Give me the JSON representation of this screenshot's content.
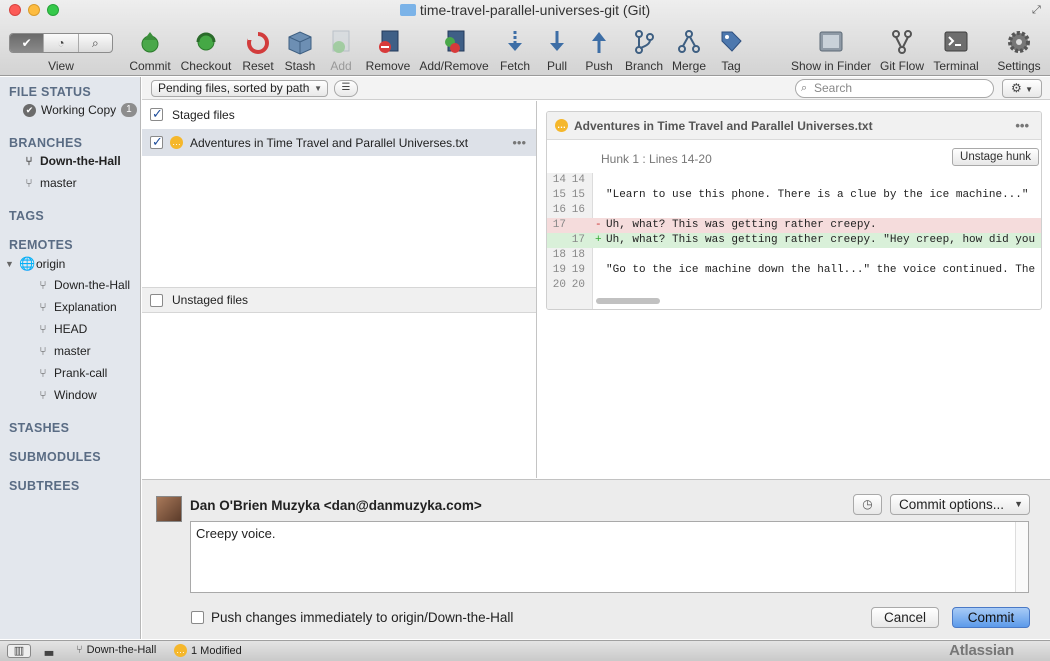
{
  "window": {
    "title": "time-travel-parallel-universes-git (Git)"
  },
  "toolbar": {
    "view_label": "View",
    "buttons": [
      {
        "label": "Commit",
        "icon": "commit-icon",
        "enabled": true
      },
      {
        "label": "Checkout",
        "icon": "checkout-icon",
        "enabled": true
      },
      {
        "label": "Reset",
        "icon": "reset-icon",
        "enabled": true
      },
      {
        "label": "Stash",
        "icon": "stash-icon",
        "enabled": true
      },
      {
        "label": "Add",
        "icon": "add-icon",
        "enabled": false
      },
      {
        "label": "Remove",
        "icon": "remove-icon",
        "enabled": true
      },
      {
        "label": "Add/Remove",
        "icon": "add-remove-icon",
        "enabled": true
      },
      {
        "label": "Fetch",
        "icon": "fetch-icon",
        "enabled": true
      },
      {
        "label": "Pull",
        "icon": "pull-icon",
        "enabled": true
      },
      {
        "label": "Push",
        "icon": "push-icon",
        "enabled": true
      },
      {
        "label": "Branch",
        "icon": "branch-icon",
        "enabled": true
      },
      {
        "label": "Merge",
        "icon": "merge-icon",
        "enabled": true
      },
      {
        "label": "Tag",
        "icon": "tag-icon",
        "enabled": true
      },
      {
        "label": "Show in Finder",
        "icon": "finder-icon",
        "enabled": true
      },
      {
        "label": "Git Flow",
        "icon": "git-flow-icon",
        "enabled": true
      },
      {
        "label": "Terminal",
        "icon": "terminal-icon",
        "enabled": true
      },
      {
        "label": "Settings",
        "icon": "gear-icon",
        "enabled": true
      }
    ]
  },
  "sidebar": {
    "file_status": {
      "header": "FILE STATUS",
      "working_copy": "Working Copy",
      "count": "1"
    },
    "branches": {
      "header": "BRANCHES",
      "items": [
        "Down-the-Hall",
        "master"
      ],
      "current": "Down-the-Hall"
    },
    "tags": {
      "header": "TAGS"
    },
    "remotes": {
      "header": "REMOTES",
      "origin": "origin",
      "items": [
        "Down-the-Hall",
        "Explanation",
        "HEAD",
        "master",
        "Prank-call",
        "Window"
      ]
    },
    "stashes": {
      "header": "STASHES"
    },
    "submodules": {
      "header": "SUBMODULES"
    },
    "subtrees": {
      "header": "SUBTREES"
    }
  },
  "filter": {
    "sort_label": "Pending files, sorted by path",
    "search_placeholder": "Search"
  },
  "files": {
    "staged_header": "Staged files",
    "staged": [
      {
        "name": "Adventures in Time Travel and Parallel Universes.txt",
        "status": "modified"
      }
    ],
    "unstaged_header": "Unstaged files"
  },
  "diff": {
    "filename": "Adventures in Time Travel and Parallel Universes.txt",
    "hunk_label": "Hunk 1 : Lines 14-20",
    "unstage_label": "Unstage hunk",
    "lines": [
      {
        "old": "14",
        "new": "14",
        "mark": "",
        "text": "",
        "type": "ctx"
      },
      {
        "old": "15",
        "new": "15",
        "mark": "",
        "text": "\"Learn to use this phone. There is a clue by the ice machine...\"",
        "type": "ctx"
      },
      {
        "old": "16",
        "new": "16",
        "mark": "",
        "text": "",
        "type": "ctx"
      },
      {
        "old": "17",
        "new": "",
        "mark": "-",
        "text": "Uh, what? This was getting rather creepy.",
        "type": "del"
      },
      {
        "old": "",
        "new": "17",
        "mark": "+",
        "text": "Uh, what? This was getting rather creepy. \"Hey creep, how did you get th",
        "type": "add"
      },
      {
        "old": "18",
        "new": "18",
        "mark": "",
        "text": "",
        "type": "ctx"
      },
      {
        "old": "19",
        "new": "19",
        "mark": "",
        "text": "\"Go to the ice machine down the hall...\" the voice continued. The whole",
        "type": "ctx"
      },
      {
        "old": "20",
        "new": "20",
        "mark": "",
        "text": "",
        "type": "ctx"
      }
    ]
  },
  "commit": {
    "author": "Dan O'Brien Muzyka <dan@danmuzyka.com>",
    "options_label": "Commit options...",
    "message": "Creepy voice.",
    "push_label": "Push changes immediately to origin/Down-the-Hall",
    "cancel_label": "Cancel",
    "commit_label": "Commit"
  },
  "status": {
    "branch": "Down-the-Hall",
    "modified": "1 Modified",
    "brand": "Atlassian"
  },
  "colors": {
    "accent": "#5c9aea",
    "deleted_bg": "#f5dcdc",
    "added_bg": "#d9f0d9",
    "modified": "#f5b72b"
  }
}
